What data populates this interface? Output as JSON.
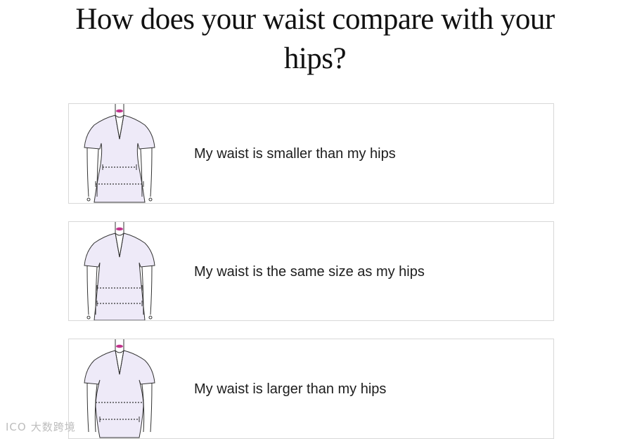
{
  "question": {
    "title": "How does your waist compare with your hips?"
  },
  "options": [
    {
      "label": "My waist is smaller than my hips",
      "figure_icon": "body-shape-waist-smaller-icon"
    },
    {
      "label": "My waist is the same size as my hips",
      "figure_icon": "body-shape-waist-same-icon"
    },
    {
      "label": "My waist is larger than my hips",
      "figure_icon": "body-shape-waist-larger-icon"
    }
  ],
  "watermark": {
    "logo_text": "ICO",
    "text": "大数跨境"
  },
  "colors": {
    "shirt_fill": "#eeeaf8",
    "outline": "#333333",
    "lips": "#c2348c",
    "card_border": "#d8d8d8",
    "text": "#111111"
  }
}
